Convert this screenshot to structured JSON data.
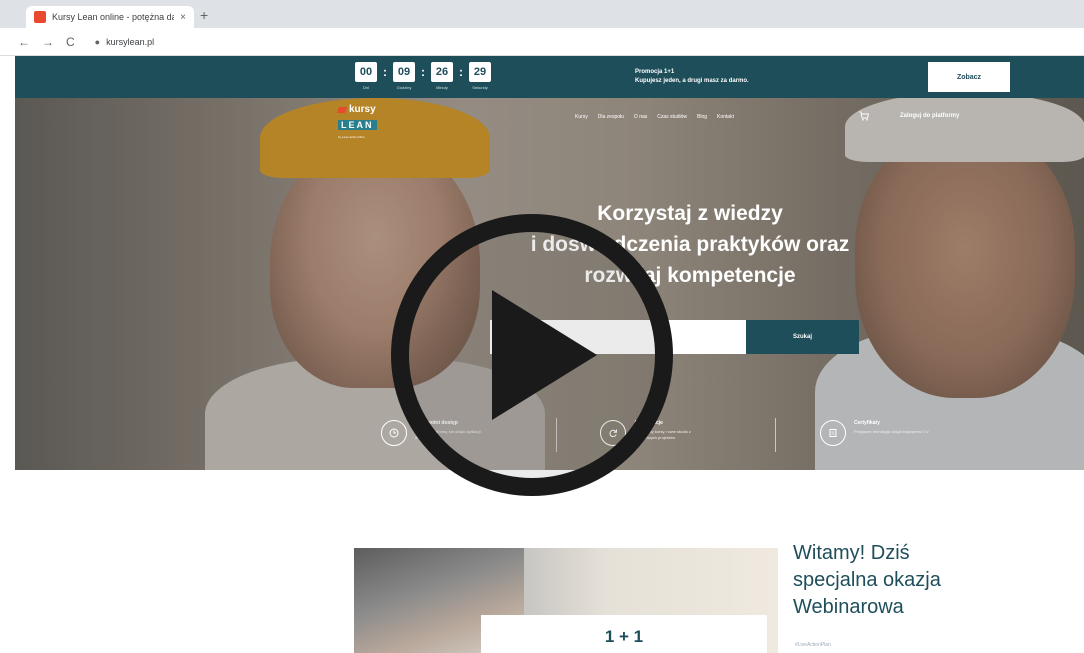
{
  "browser": {
    "tab_title": "Kursy Lean online - potężna da...",
    "tab_close": "×",
    "new_tab": "+",
    "back": "←",
    "forward": "→",
    "reload": "C",
    "url": "kursylean.pl"
  },
  "promo": {
    "countdown": [
      {
        "value": "00",
        "label": "Dni"
      },
      {
        "value": "09",
        "label": "Godziny"
      },
      {
        "value": "26",
        "label": "Minuty"
      },
      {
        "value": "29",
        "label": "Sekundy"
      }
    ],
    "separator": ":",
    "text_line1": "Promocja 1+1",
    "text_line2": "Kupujesz jeden, a drugi masz za darmo.",
    "button": "Zobacz"
  },
  "hero": {
    "logo_top": "kursy",
    "logo_lean": "LEAN",
    "logo_sub": "by Lean Action Plan",
    "nav": [
      "Kursy",
      "Dla zespołu",
      "O nas",
      "Czas studiów",
      "Blog",
      "Kontakt"
    ],
    "login": "Zaloguj do platformy",
    "headline_1": "Korzystaj z wiedzy",
    "headline_2": "i doświadczenia praktyków oraz",
    "headline_3": "rozwijaj kompetencje",
    "search_placeholder": "Czego szukasz?",
    "search_button": "Szukaj",
    "features": [
      {
        "title": "Dożywotni dostęp",
        "desc": "Poprzez platformę lub dzięki aplikacji mobilnej"
      },
      {
        "title": "Aktualizacje",
        "desc": "Ulepszamy kursy, nowe studia z prawdziwych projektów"
      },
      {
        "title": "Certyfikaty",
        "desc": "Przyjazne rekrutacja dzięki krajowemu CV"
      }
    ]
  },
  "content": {
    "card_number": "1 + 1",
    "welcome_1": "Witamy! Dziś",
    "welcome_2": "specjalna okazja",
    "welcome_3": "Webinarowa",
    "hashtag": "#LiveActionPlan"
  },
  "colors": {
    "brand_teal": "#1f4e5b",
    "accent_red": "#e8492f"
  }
}
